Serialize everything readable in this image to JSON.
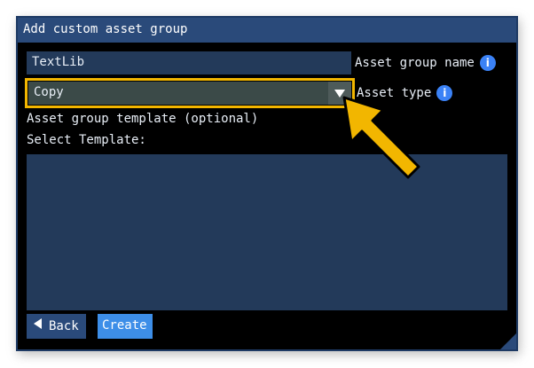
{
  "dialog": {
    "title": "Add custom asset group",
    "name_field": {
      "value": "TextLib",
      "label": "Asset group name"
    },
    "type_field": {
      "value": "Copy",
      "label": "Asset type"
    },
    "template_label": "Asset group template (optional)",
    "select_template_label": "Select Template:",
    "back_label": "Back",
    "create_label": "Create",
    "info_glyph": "i"
  },
  "colors": {
    "title_bar": "#2a4a7a",
    "field_bg": "#233a5a",
    "highlight_outline": "#f2b600",
    "pointer_arrow": "#f2b600",
    "create_button": "#3d8ee8"
  },
  "icons": [
    "info-icon",
    "dropdown-arrow-icon",
    "back-arrow-icon",
    "pointer-arrow-annotation",
    "resize-grip"
  ]
}
